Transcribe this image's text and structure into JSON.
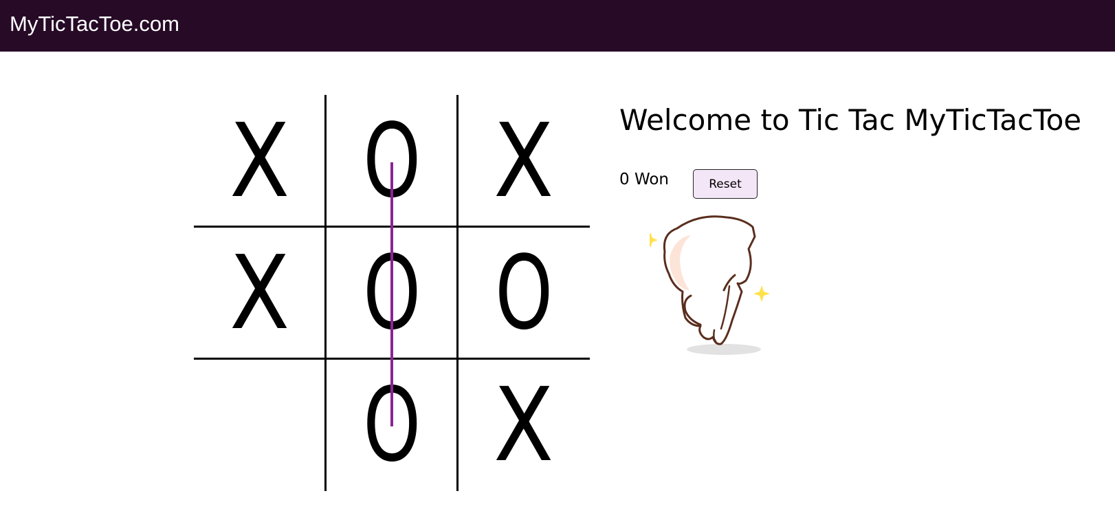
{
  "header": {
    "site_title": "MyTicTacToe.com"
  },
  "board": {
    "cells": [
      "X",
      "O",
      "X",
      "X",
      "O",
      "O",
      "",
      "O",
      "X"
    ],
    "winning_line": {
      "cells": [
        1,
        4,
        7
      ],
      "color": "#8b2593"
    }
  },
  "info": {
    "welcome_title": "Welcome to Tic Tac MyTicTacToe",
    "won_text": "0 Won",
    "reset_label": "Reset"
  },
  "image": {
    "icon": "celebrating-cat-icon"
  },
  "colors": {
    "header_bg": "#260a26",
    "reset_bg": "#f3e6f7",
    "win_line": "#8b2593",
    "sparkle": "#ffe14d"
  }
}
